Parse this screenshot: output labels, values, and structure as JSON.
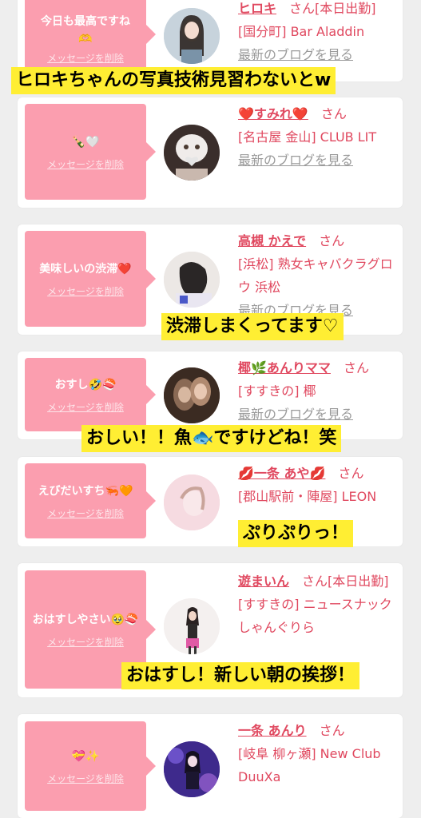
{
  "cards": [
    {
      "message": "今日も最高ですね",
      "emoji": "🫶",
      "delete_label": "メッセージを削除",
      "name": "ヒロキ",
      "san": "さん",
      "badge": "[本日出勤]",
      "shop": "[国分町] Bar Aladdin",
      "blog": "最新のブログを見る",
      "avatar_color": "#d8dfe6"
    },
    {
      "message": "🍾🤍",
      "delete_label": "メッセージを削除",
      "name": "❤️すみれ❤️",
      "san": "さん",
      "shop": "[名古屋 金山] CLUB LIT",
      "blog": "最新のブログを見る",
      "avatar_color": "#bba8a0"
    },
    {
      "message": "美味しいの渋滞❤️",
      "delete_label": "メッセージを削除",
      "name": "高槻 かえで",
      "san": "さん",
      "shop": "[浜松] 熟女キャバクラグロウ 浜松",
      "blog": "最新のブログを見る",
      "avatar_color": "#e7e1de"
    },
    {
      "message": "おすし🤣🍣",
      "delete_label": "メッセージを削除",
      "name": "椰🌿あんりママ",
      "san": "さん",
      "shop": "[すすきの] 椰",
      "blog": "最新のブログを見る",
      "avatar_color": "#6b4a3a"
    },
    {
      "message": "えびだいすち🦐🧡",
      "delete_label": "メッセージを削除",
      "name": "💋一条 あや💋",
      "san": "さん",
      "shop": "[郡山駅前・陣屋] LEON",
      "avatar_color": "#f3d3da"
    },
    {
      "message": "おはすしやさい🥹🍣",
      "delete_label": "メッセージを削除",
      "name": "遊まいん",
      "san": "さん",
      "badge": "[本日出勤]",
      "shop": "[すすきの] ニュースナックしゃんぐりら",
      "avatar_color": "#efe8e8"
    },
    {
      "message": "💝✨",
      "delete_label": "メッセージを削除",
      "name": "一条 あんり",
      "san": "さん",
      "shop": "[岐阜 柳ヶ瀬] New Club DuuXa",
      "avatar_color": "#5a3fa8"
    }
  ],
  "captions": [
    "ヒロキちゃんの写真技術見習わないとw",
    "渋滞しまくってます♡",
    "おしい！！魚🐟ですけどね！笑",
    "ぷりぷりっ！",
    "おはすし！新しい朝の挨拶！"
  ]
}
